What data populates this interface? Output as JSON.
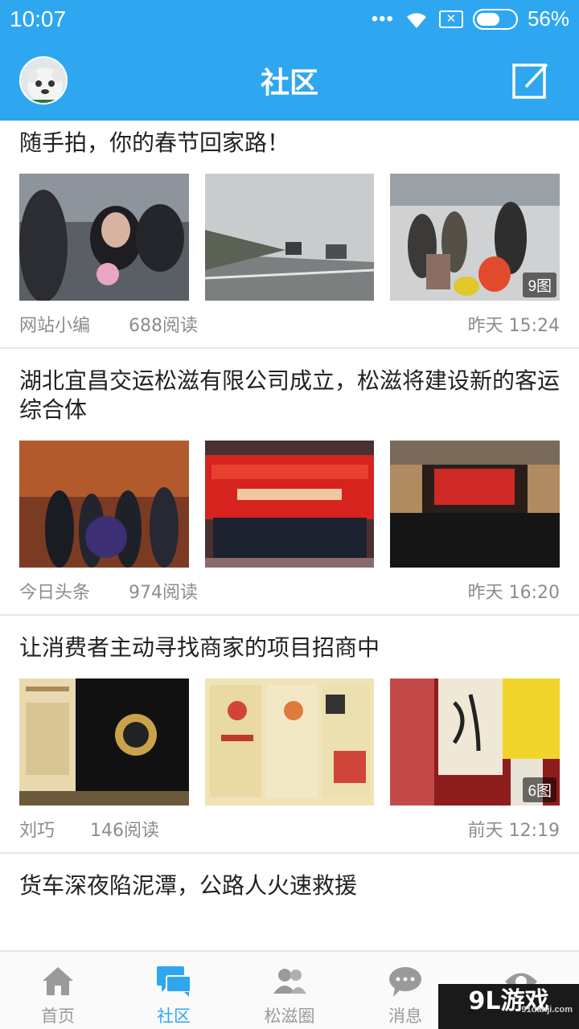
{
  "status_bar": {
    "time": "10:07",
    "signal_dots": "•••",
    "battery_percent": "56%"
  },
  "header": {
    "title": "社区"
  },
  "posts": [
    {
      "title": "随手拍，你的春节回家路！",
      "author": "网站小编",
      "reads": "688阅读",
      "time": "昨天 15:24",
      "image_count": "9图"
    },
    {
      "title": "湖北宜昌交运松滋有限公司成立，松滋将建设新的客运综合体",
      "author": "今日头条",
      "reads": "974阅读",
      "time": "昨天 16:20"
    },
    {
      "title": "让消费者主动寻找商家的项目招商中",
      "author": "刘巧",
      "reads": "146阅读",
      "time": "前天 12:19",
      "image_count": "6图"
    },
    {
      "title": "货车深夜陷泥潭，公路人火速救援"
    }
  ],
  "bottom_nav": [
    {
      "label": "首页",
      "icon": "home-icon"
    },
    {
      "label": "社区",
      "icon": "chat-bubbles-icon",
      "active": true
    },
    {
      "label": "松滋圈",
      "icon": "group-icon"
    },
    {
      "label": "消息",
      "icon": "message-icon"
    },
    {
      "label": "",
      "icon": "eye-icon"
    }
  ],
  "watermark": {
    "text": "9L游戏",
    "url": "91danji.com"
  },
  "colors": {
    "primary": "#2ea7f0",
    "text": "#222222",
    "muted": "#8c8c8c"
  }
}
